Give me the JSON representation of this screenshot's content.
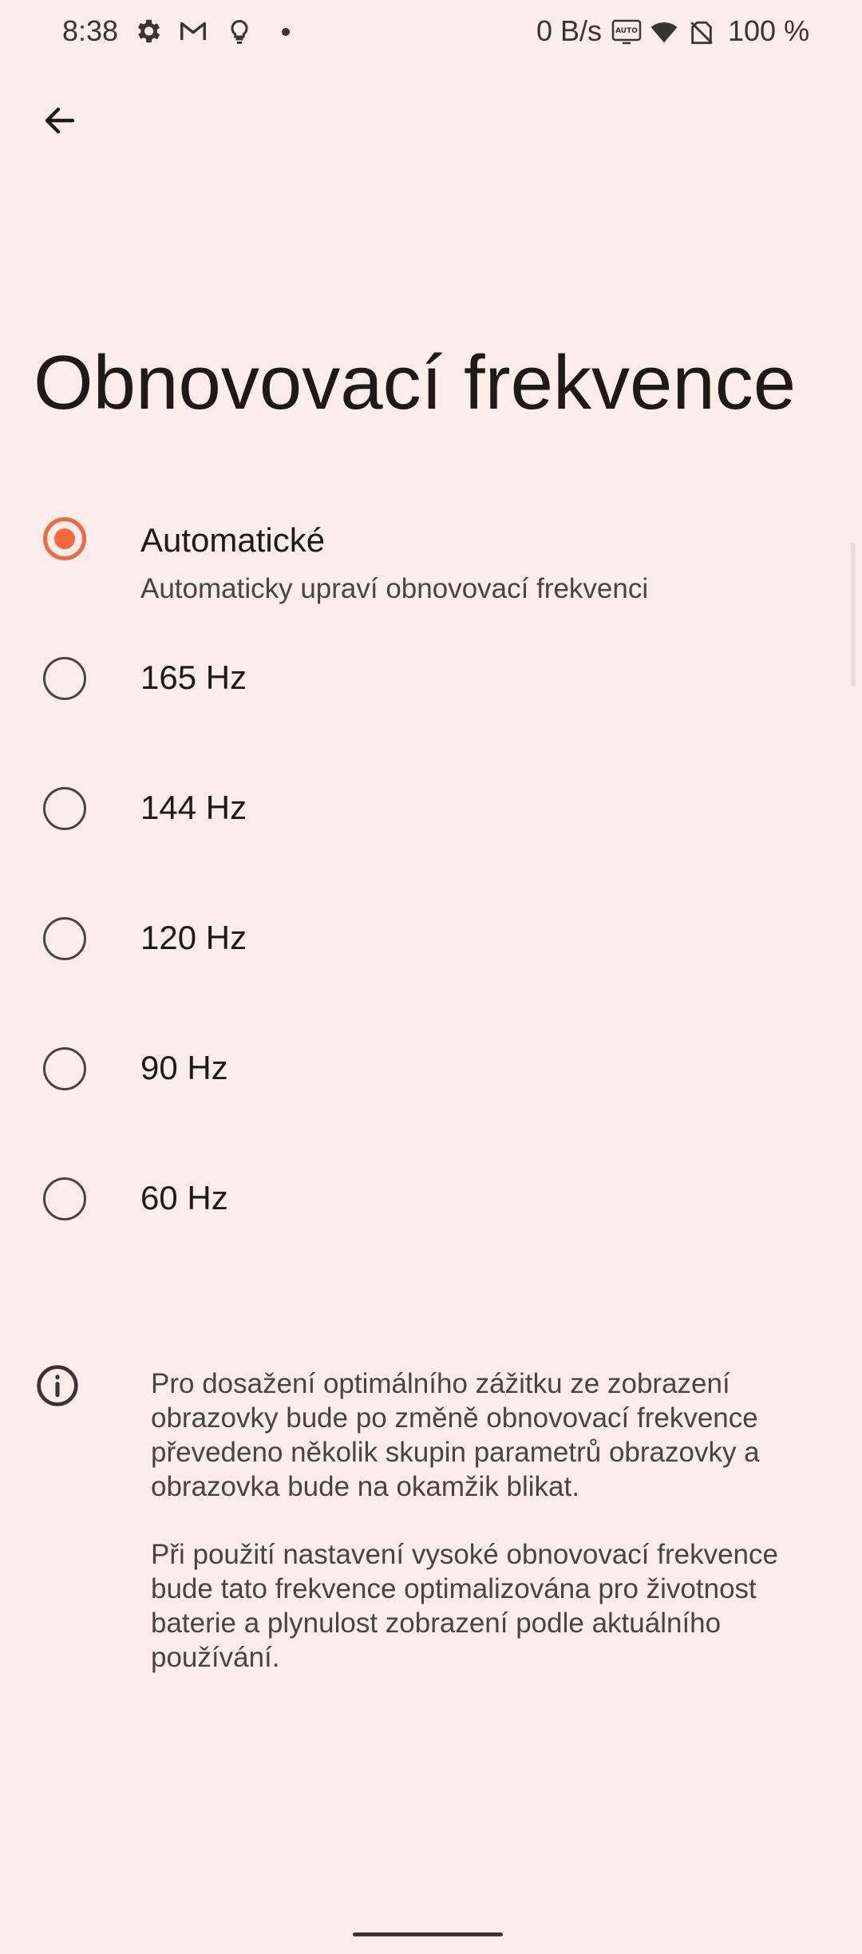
{
  "status_bar": {
    "time": "8:38",
    "network_speed": "0 B/s",
    "battery": "100 %",
    "icons": [
      "gear-icon",
      "gmail-icon",
      "lightbulb-icon",
      "dot-icon",
      "auto-hz-icon",
      "wifi-icon",
      "no-sim-icon"
    ]
  },
  "header": {
    "back_icon": "arrow-left-icon"
  },
  "page": {
    "title": "Obnovovací frekvence"
  },
  "options": [
    {
      "label": "Automatické",
      "summary": "Automaticky upraví obnovovací frekvenci",
      "selected": true
    },
    {
      "label": "165 Hz",
      "selected": false
    },
    {
      "label": "144 Hz",
      "selected": false
    },
    {
      "label": "120 Hz",
      "selected": false
    },
    {
      "label": "90 Hz",
      "selected": false
    },
    {
      "label": "60 Hz",
      "selected": false
    }
  ],
  "info": {
    "icon": "info-icon",
    "paragraph1": "Pro dosažení optimálního zážitku ze zobrazení obrazovky bude po změně obnovovací frekvence převedeno několik skupin parametrů obrazovky a obrazovka bude na okamžik blikat.",
    "paragraph2": "Při použití nastavení vysoké obnovovací frekvence bude tato frekvence optimalizována pro životnost baterie a plynulost zobrazení podle aktuálního používání."
  },
  "colors": {
    "background": "#fbeeea",
    "accent": "#f26a3c",
    "text_primary": "#1f1a18",
    "text_secondary": "#4a4441"
  }
}
